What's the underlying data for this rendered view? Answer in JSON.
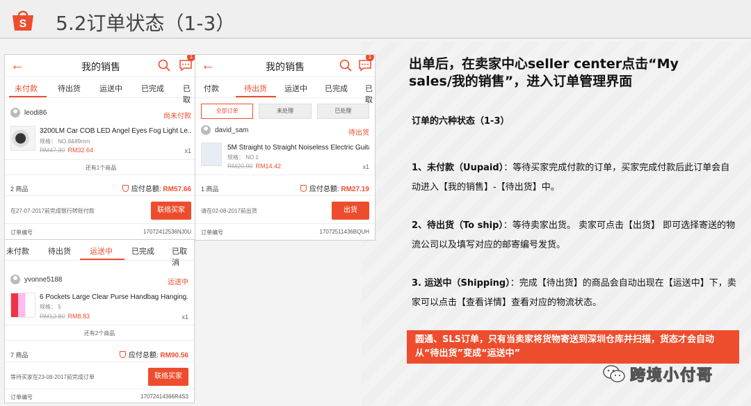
{
  "slide": {
    "title": "5.2订单状态（1-3）"
  },
  "phone1": {
    "title": "我的销售",
    "badge": "1",
    "tabs": [
      "未付款",
      "待出货",
      "运送中",
      "已完成",
      "已取"
    ],
    "user": "leodi86",
    "status": "尚未付款",
    "product": "3200LM Car COB LED Angel Eyes Fog Light Le...",
    "spec": "规格： NO.8&89mm",
    "old_price": "RM47.30",
    "new_price": "RM32.64",
    "qty": "x1",
    "more": "还有1个商品",
    "count": "2 商品",
    "total_label": "应付总额:",
    "total": "RM57.66",
    "note": "在27-07-2017前完成银行转账付款",
    "button": "联络买家",
    "orderno_label": "订单编号",
    "orderno": "17072412536NJ0U"
  },
  "phone2": {
    "title": "我的销售",
    "badge": "1",
    "tabs": [
      "付款",
      "待出货",
      "运送中",
      "已完成",
      "已取"
    ],
    "filters": [
      "全部订单",
      "未处理",
      "已处理"
    ],
    "user": "david_sam",
    "status": "待出货",
    "product": "5M Straight to Straight Noiseless Electric Guitar...",
    "spec": "规格： NO.1",
    "old_price": "RM20.90",
    "new_price": "RM14.42",
    "qty": "x1",
    "count": "1 商品",
    "total_label": "应付总额:",
    "total": "RM27.19",
    "note": "请在02-08-2017前出货",
    "button": "出货",
    "orderno_label": "订单编号",
    "orderno": "17072511436BQUH"
  },
  "phone3": {
    "tabs": [
      "未付款",
      "待出货",
      "运送中",
      "已完成",
      "已取消"
    ],
    "user": "yvonne5188",
    "status": "运送中",
    "product": "6 Pockets Large Clear Purse Handbag Hanging...",
    "spec": "规格： 5",
    "old_price": "RM12.80",
    "new_price": "RM8.83",
    "qty": "x1",
    "more": "还有2个商品",
    "count": "7 商品",
    "total_label": "应付总额:",
    "total": "RM90.56",
    "note": "等待买家在23-08-2017前完成订单",
    "button": "联络买家",
    "orderno_label": "订单编号",
    "orderno": "17072414366R4S3"
  },
  "right": {
    "headline": "出单后，在卖家中心seller center点击“My sales/我的销售”，进入订单管理界面",
    "subtitle": "订单的六种状态（1-3）",
    "p1_bold": "1、未付款（Uupaid）",
    "p1_text": "：等待买家完成付款的订单，买家完成付款后此订单会自动进入【我的销售】-【待出货】中。",
    "p2_bold": "2、待出货（To ship）",
    "p2_text": "：等待卖家出货。 卖家可点击【出货】 即可选择寄送的物流公司以及填写对应的邮寄编号发货。",
    "p3_bold": "3. 运送中（Shipping）",
    "p3_text": "：完成【待出货】的商品会自动出现在【运送中】下，卖家可以点击【查看详情】查看对应的物流状态。",
    "callout": "圆通、SLS订单，只有当卖家将货物寄送到深圳仓库并扫描，货态才会自动从“待出货”变成“运送中”",
    "watermark": "跨境小付哥"
  },
  "colors": {
    "accent": "#ee4d2d",
    "header_bg": "#efefef"
  }
}
